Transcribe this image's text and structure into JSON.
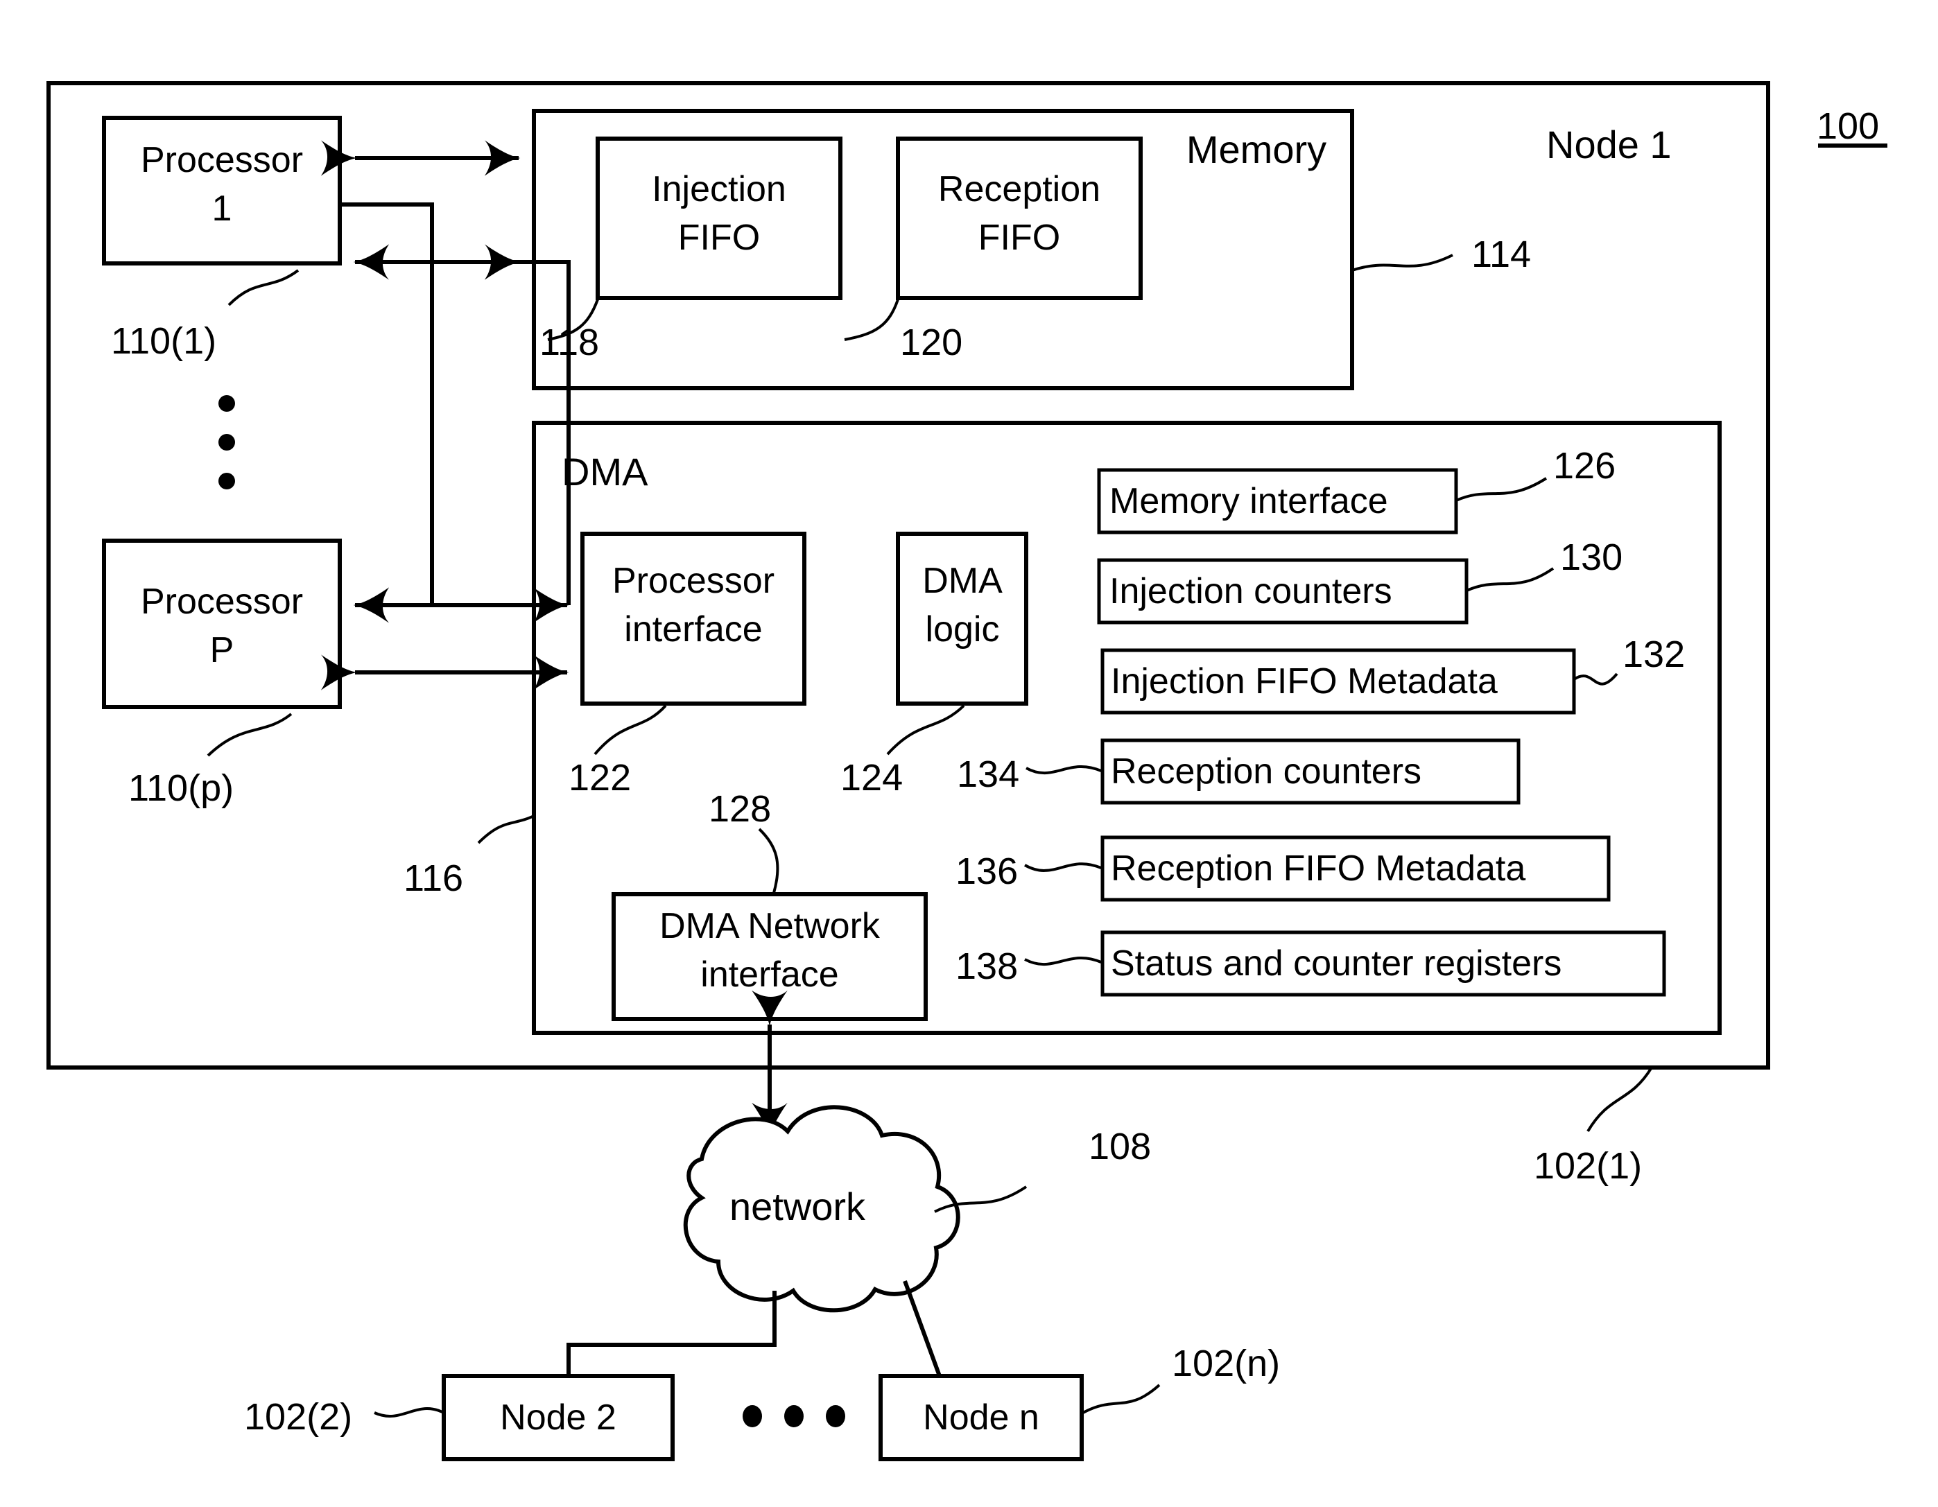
{
  "figure": {
    "figure_number": "100",
    "node_label": "Node 1",
    "node_ref": "102(1)"
  },
  "processors": {
    "first": {
      "line1": "Processor",
      "line2": "1",
      "ref": "110(1)"
    },
    "last": {
      "line1": "Processor",
      "line2": "P",
      "ref": "110(p)"
    },
    "ellipsis": "vertical-dots"
  },
  "memory": {
    "title": "Memory",
    "ref": "114",
    "blocks": [
      {
        "line1": "Injection",
        "line2": "FIFO",
        "ref": "118"
      },
      {
        "line1": "Reception",
        "line2": "FIFO",
        "ref": "120"
      }
    ]
  },
  "dma": {
    "title": "DMA",
    "ref": "116",
    "left_blocks": [
      {
        "line1": "Processor",
        "line2": "interface",
        "ref": "122"
      },
      {
        "line1": "DMA",
        "line2": "logic",
        "ref": "124"
      },
      {
        "line1": "DMA Network",
        "line2": "interface",
        "ref": "128"
      }
    ],
    "right_blocks": [
      {
        "label": "Memory interface",
        "ref": "126"
      },
      {
        "label": "Injection counters",
        "ref": "130"
      },
      {
        "label": "Injection FIFO Metadata",
        "ref": "132"
      },
      {
        "label": "Reception counters",
        "ref": "134"
      },
      {
        "label": "Reception FIFO Metadata",
        "ref": "136"
      },
      {
        "label": "Status and counter registers",
        "ref": "138"
      }
    ]
  },
  "network": {
    "label": "network",
    "ref": "108"
  },
  "other_nodes": [
    {
      "label": "Node 2",
      "ref": "102(2)"
    },
    {
      "label": "Node n",
      "ref": "102(n)"
    }
  ],
  "node_ellipsis": "horizontal-dots"
}
